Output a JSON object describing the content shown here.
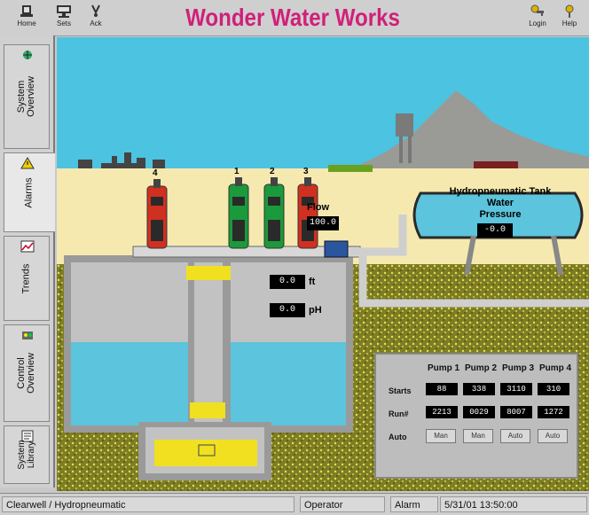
{
  "toolbar": {
    "home_label": "Home",
    "sets_label": "Sets",
    "ack_label": "Ack",
    "login_label": "Login",
    "help_label": "Help"
  },
  "app": {
    "title": "Wonder Water Works"
  },
  "sidebar": {
    "items": [
      {
        "label": "System Overview",
        "icon": "globe-icon"
      },
      {
        "label": "Alarms",
        "icon": "warning-icon"
      },
      {
        "label": "Trends",
        "icon": "trend-chart-icon"
      },
      {
        "label": "Control Overview",
        "icon": "control-icon"
      },
      {
        "label": "System Library",
        "icon": "library-icon"
      }
    ]
  },
  "scene": {
    "flow_label": "Flow",
    "flow_value": "100.0",
    "tank_title": "Hydropneumatic Tank",
    "tank_sub1": "Water",
    "tank_sub2": "Pressure",
    "tank_pressure": "-0.0",
    "level_value": "0.0",
    "level_unit": "ft",
    "ph_value": "0.0",
    "ph_unit": "pH",
    "pump_numbers": [
      "4",
      "1",
      "2",
      "3"
    ]
  },
  "pump_panel": {
    "headers": [
      "Pump 1",
      "Pump 2",
      "Pump 3",
      "Pump 4"
    ],
    "row_labels": [
      "Starts",
      "Run#",
      "Auto"
    ],
    "starts": [
      "88",
      "338",
      "3110",
      "310"
    ],
    "run_hours": [
      "2213",
      "0029",
      "8007",
      "1272"
    ],
    "mode": [
      "Man",
      "Man",
      "Auto",
      "Auto"
    ]
  },
  "status": {
    "location": "Clearwell / Hydropneumatic",
    "user": "Operator",
    "alarm_label": "Alarm",
    "datetime": "5/31/01 13:50:00"
  },
  "colors": {
    "title": "#d0207a",
    "sky": "#4cc3e0",
    "sand": "#f6e9b0",
    "water": "#5cc4dc",
    "ground": "#8a8a2a"
  }
}
